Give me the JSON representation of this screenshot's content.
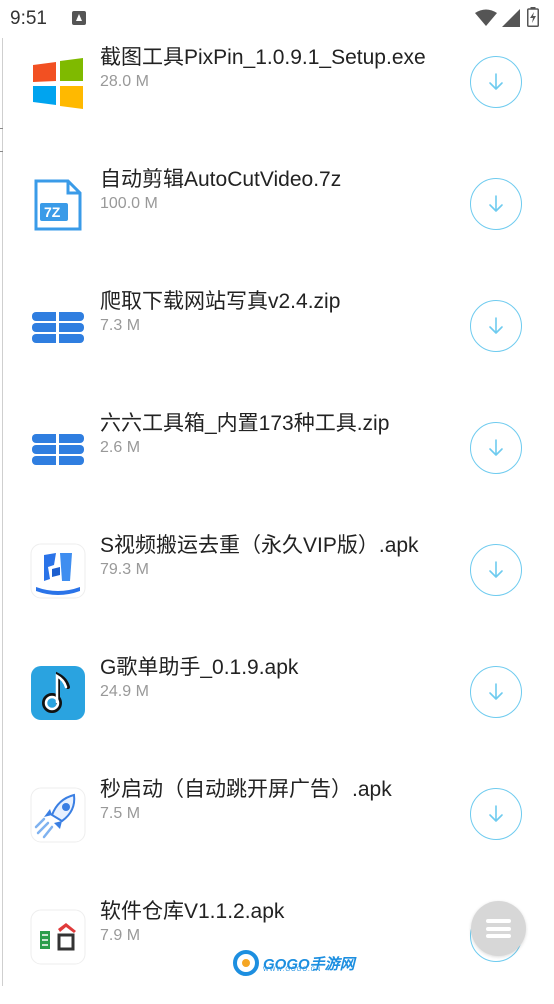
{
  "status_bar": {
    "time": "9:51",
    "icons": [
      "notification-a-icon",
      "wifi-icon",
      "signal-icon",
      "battery-icon"
    ]
  },
  "files": [
    {
      "name": "截图工具PixPin_1.0.9.1_Setup.exe",
      "size": "28.0 M",
      "icon": "windows-logo-icon"
    },
    {
      "name": "自动剪辑AutoCutVideo.7z",
      "size": "100.0 M",
      "icon": "7z-file-icon"
    },
    {
      "name": "爬取下载网站写真v2.4.zip",
      "size": "7.3 M",
      "icon": "zip-archive-icon"
    },
    {
      "name": "六六工具箱_内置173种工具.zip",
      "size": "2.6 M",
      "icon": "zip-archive-icon"
    },
    {
      "name": "S视频搬运去重（永久VIP版）.apk",
      "size": "79.3 M",
      "icon": "video-dedup-app-icon"
    },
    {
      "name": "G歌单助手_0.1.9.apk",
      "size": "24.9 M",
      "icon": "music-note-app-icon"
    },
    {
      "name": "秒启动（自动跳开屏广告）.apk",
      "size": "7.5 M",
      "icon": "rocket-app-icon"
    },
    {
      "name": "软件仓库V1.1.2.apk",
      "size": "7.9 M",
      "icon": "software-store-app-icon"
    }
  ],
  "watermark": {
    "brand": "GOGO手游网",
    "domain": "WWW.GOGO.CN"
  },
  "colors": {
    "accent": "#6ecbef",
    "zip_blue": "#2f7ee0",
    "text_primary": "#222222",
    "text_secondary": "#999999"
  }
}
